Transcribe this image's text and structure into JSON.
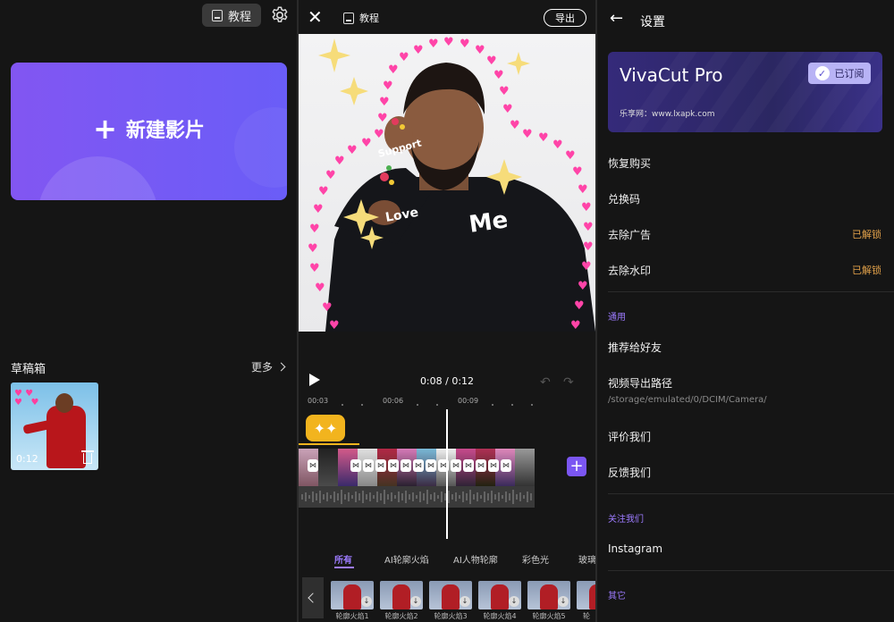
{
  "home": {
    "tutorial_label": "教程",
    "new_project_label": "新建影片",
    "drafts_title": "草稿箱",
    "more_label": "更多",
    "draft_duration": "0:12"
  },
  "editor": {
    "tutorial_label": "教程",
    "export_label": "导出",
    "time": "0:08 / 0:12",
    "ruler_ticks": [
      "00:03",
      "00:06",
      "00:09"
    ],
    "stickers": {
      "support": "Support",
      "love": "Love",
      "me": "Me"
    },
    "categories": [
      "所有",
      "AI轮廓火焰",
      "AI人物轮廓",
      "彩色光",
      "玻璃"
    ],
    "effects": [
      "轮廓火焰1",
      "轮廓火焰2",
      "轮廓火焰3",
      "轮廓火焰4",
      "轮廓火焰5",
      "轮"
    ],
    "accent": "#7b56f2",
    "sticker_color": "#f2b41e"
  },
  "settings": {
    "title": "设置",
    "pro": {
      "name": "VivaCut Pro",
      "badge": "已订阅",
      "site": "乐享网：www.lxapk.com"
    },
    "rows": [
      {
        "label": "恢复购买"
      },
      {
        "label": "兑换码"
      },
      {
        "label": "去除广告",
        "value": "已解锁"
      },
      {
        "label": "去除水印",
        "value": "已解锁"
      }
    ],
    "section_general": "通用",
    "general": [
      {
        "label": "推荐给好友"
      },
      {
        "label": "视频导出路径",
        "sub": "/storage/emulated/0/DCIM/Camera/"
      },
      {
        "label": "评价我们"
      },
      {
        "label": "反馈我们"
      }
    ],
    "section_follow": "关注我们",
    "follow": [
      {
        "label": "Instagram"
      }
    ],
    "section_other": "其它",
    "accent": "#9d7bff",
    "unlocked_color": "#e3a24a"
  }
}
